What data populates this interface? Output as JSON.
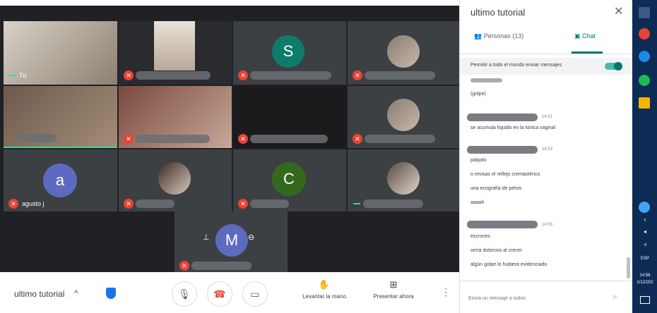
{
  "grid": {
    "self_label": "Tú",
    "agusto_name": "agusto j",
    "avatar_s": "S",
    "avatar_a": "a",
    "avatar_c": "C",
    "avatar_m": "M"
  },
  "colors": {
    "avatar_s": "#0f7b6c",
    "avatar_a": "#5c6bc0",
    "avatar_c": "#33691e",
    "avatar_m": "#5c6bc0",
    "accent": "#00796b",
    "mic_off": "#ea4335"
  },
  "bottombar": {
    "meeting_title": "ultimo tutorial",
    "raise_hand": "Levantar la mano",
    "present_now": "Presentar ahora"
  },
  "panel": {
    "title": "ultimo tutorial",
    "tab_people": "Personas (13)",
    "tab_chat": "Chat",
    "setting_label": "Permitir a todo el mundo enviar mensajes",
    "messages": [
      {
        "text": "(golpe)"
      },
      {
        "time": "14:51"
      },
      {
        "text": "se acumula líquido en la túnica vaginal"
      },
      {
        "time": "14:53"
      },
      {
        "text": "palpalo"
      },
      {
        "text": "o revisas el reflejo cremastérico"
      },
      {
        "text": "una ecografía de pelvis"
      },
      {
        "text": "aaaah"
      },
      {
        "time": "14:55"
      },
      {
        "text": "escroves"
      },
      {
        "text": "sería doloroso al crecer"
      },
      {
        "text": "algún golpe lo hubiera evidenciado"
      }
    ],
    "input_placeholder": "Envía un mensaje a todos"
  },
  "taskbar": {
    "lang": "ESP",
    "time": "14:56",
    "date": "1/12/202"
  }
}
